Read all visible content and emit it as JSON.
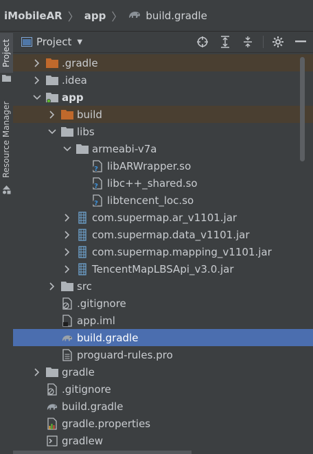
{
  "breadcrumb": {
    "project": "iMobileAR",
    "module": "app",
    "file": "build.gradle"
  },
  "left_strip": {
    "project_tab": "Project",
    "resource_manager_tab": "Resource Manager"
  },
  "panel": {
    "title": "Project",
    "toolbar_icons": [
      "locate-icon",
      "expand-all-icon",
      "collapse-all-icon",
      "settings-icon",
      "hide-icon"
    ]
  },
  "tree": [
    {
      "label": ".gradle",
      "icon": "folder-orange",
      "arrow": "right",
      "depth": 0,
      "state": "highlight"
    },
    {
      "label": ".idea",
      "icon": "folder",
      "arrow": "right",
      "depth": 0
    },
    {
      "label": "app",
      "icon": "module-folder",
      "arrow": "down",
      "depth": 0,
      "bold": true
    },
    {
      "label": "build",
      "icon": "folder-orange",
      "arrow": "right",
      "depth": 1,
      "state": "highlight"
    },
    {
      "label": "libs",
      "icon": "folder",
      "arrow": "down",
      "depth": 1
    },
    {
      "label": "armeabi-v7a",
      "icon": "folder",
      "arrow": "down",
      "depth": 2
    },
    {
      "label": "libARWrapper.so",
      "icon": "unknown-file",
      "arrow": "",
      "depth": 3
    },
    {
      "label": "libc++_shared.so",
      "icon": "unknown-file",
      "arrow": "",
      "depth": 3
    },
    {
      "label": "libtencent_loc.so",
      "icon": "unknown-file",
      "arrow": "",
      "depth": 3
    },
    {
      "label": "com.supermap.ar_v1101.jar",
      "icon": "jar",
      "arrow": "right",
      "depth": 2
    },
    {
      "label": "com.supermap.data_v1101.jar",
      "icon": "jar",
      "arrow": "right",
      "depth": 2
    },
    {
      "label": "com.supermap.mapping_v1101.jar",
      "icon": "jar",
      "arrow": "right",
      "depth": 2
    },
    {
      "label": "TencentMapLBSApi_v3.0.jar",
      "icon": "jar",
      "arrow": "right",
      "depth": 2
    },
    {
      "label": "src",
      "icon": "folder",
      "arrow": "right",
      "depth": 1
    },
    {
      "label": ".gitignore",
      "icon": "ignore-file",
      "arrow": "",
      "depth": 1
    },
    {
      "label": "app.iml",
      "icon": "iml-file",
      "arrow": "",
      "depth": 1
    },
    {
      "label": "build.gradle",
      "icon": "gradle",
      "arrow": "",
      "depth": 1,
      "state": "selected"
    },
    {
      "label": "proguard-rules.pro",
      "icon": "text-file",
      "arrow": "",
      "depth": 1
    },
    {
      "label": "gradle",
      "icon": "folder",
      "arrow": "right",
      "depth": 0
    },
    {
      "label": ".gitignore",
      "icon": "ignore-file",
      "arrow": "",
      "depth": 0
    },
    {
      "label": "build.gradle",
      "icon": "gradle",
      "arrow": "",
      "depth": 0
    },
    {
      "label": "gradle.properties",
      "icon": "properties-file",
      "arrow": "",
      "depth": 0
    },
    {
      "label": "gradlew",
      "icon": "shell-file",
      "arrow": "",
      "depth": 0
    }
  ]
}
